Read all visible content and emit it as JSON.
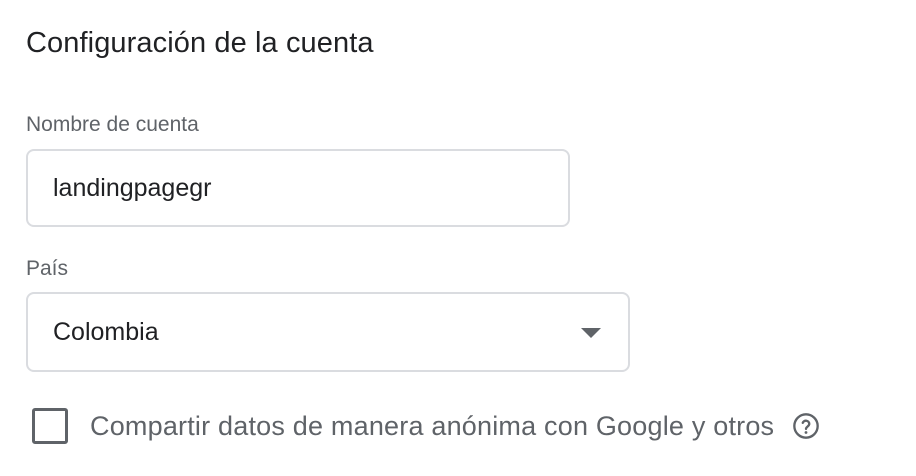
{
  "section": {
    "title": "Configuración de la cuenta"
  },
  "account_name": {
    "label": "Nombre de cuenta",
    "value": "landingpagegr"
  },
  "country": {
    "label": "País",
    "selected": "Colombia"
  },
  "share_data": {
    "label": "Compartir datos de manera anónima con Google y otros",
    "checked": false,
    "help_icon": "help-circle-icon"
  },
  "colors": {
    "text_primary": "#202124",
    "text_secondary": "#5f6368",
    "border": "#dadce0"
  }
}
